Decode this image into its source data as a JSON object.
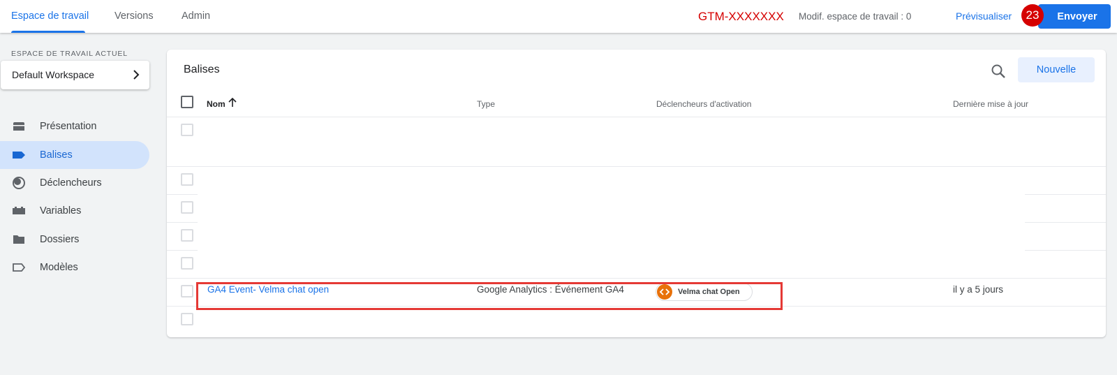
{
  "topbar": {
    "tabs": [
      {
        "label": "Espace de travail"
      },
      {
        "label": "Versions"
      },
      {
        "label": "Admin"
      }
    ],
    "container_id": "GTM-XXXXXXX",
    "modif_text": "Modif. espace de travail : 0",
    "preview_label": "Prévisualiser",
    "badge_count": "23",
    "send_label": "Envoyer"
  },
  "sidebar": {
    "workspace_label": "ESPACE DE TRAVAIL ACTUEL",
    "workspace_name": "Default Workspace",
    "items": [
      {
        "label": "Présentation",
        "icon": "overview-icon"
      },
      {
        "label": "Balises",
        "icon": "tag-icon",
        "active": true
      },
      {
        "label": "Déclencheurs",
        "icon": "trigger-icon"
      },
      {
        "label": "Variables",
        "icon": "variables-icon"
      },
      {
        "label": "Dossiers",
        "icon": "folder-icon"
      },
      {
        "label": "Modèles",
        "icon": "template-icon"
      }
    ]
  },
  "main": {
    "title": "Balises",
    "new_label": "Nouvelle",
    "columns": {
      "name": "Nom",
      "type": "Type",
      "triggers": "Déclencheurs d'activation",
      "updated": "Dernière mise à jour"
    },
    "row": {
      "name": "GA4 Event- Velma chat open",
      "type": "Google Analytics : Événement GA4",
      "trigger": "Velma chat Open",
      "updated": "il y a 5 jours"
    }
  },
  "colors": {
    "accent": "#1a73e8",
    "highlight": "#e53935",
    "container_id": "#d50000",
    "trigger_icon": "#e8710a"
  }
}
